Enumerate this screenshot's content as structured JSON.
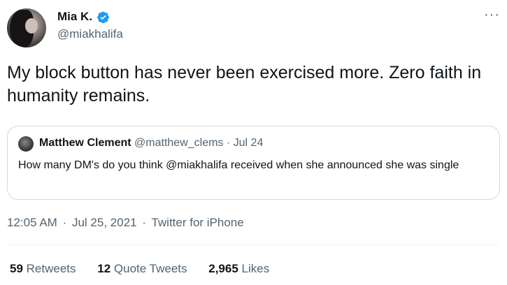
{
  "author": {
    "display_name": "Mia K.",
    "handle": "@miakhalifa",
    "verified": true
  },
  "tweet_text": "My block button has never been exercised more. Zero faith in humanity remains.",
  "quoted": {
    "display_name": "Matthew Clement",
    "handle": "@matthew_clems",
    "separator": "·",
    "date": "Jul 24",
    "text": "How many DM's do you think @miakhalifa received when she announced she was single"
  },
  "meta": {
    "time": "12:05 AM",
    "separator": "·",
    "date": "Jul 25, 2021",
    "source": "Twitter for iPhone"
  },
  "stats": {
    "retweets_count": "59",
    "retweets_label": "Retweets",
    "quotes_count": "12",
    "quotes_label": "Quote Tweets",
    "likes_count": "2,965",
    "likes_label": "Likes"
  },
  "more_label": "···",
  "colors": {
    "text": "#0f1419",
    "secondary": "#536471",
    "border": "#cfd9de",
    "verified": "#1d9bf0"
  },
  "icons": {
    "verified": "verified-badge-icon",
    "more": "more-icon"
  }
}
